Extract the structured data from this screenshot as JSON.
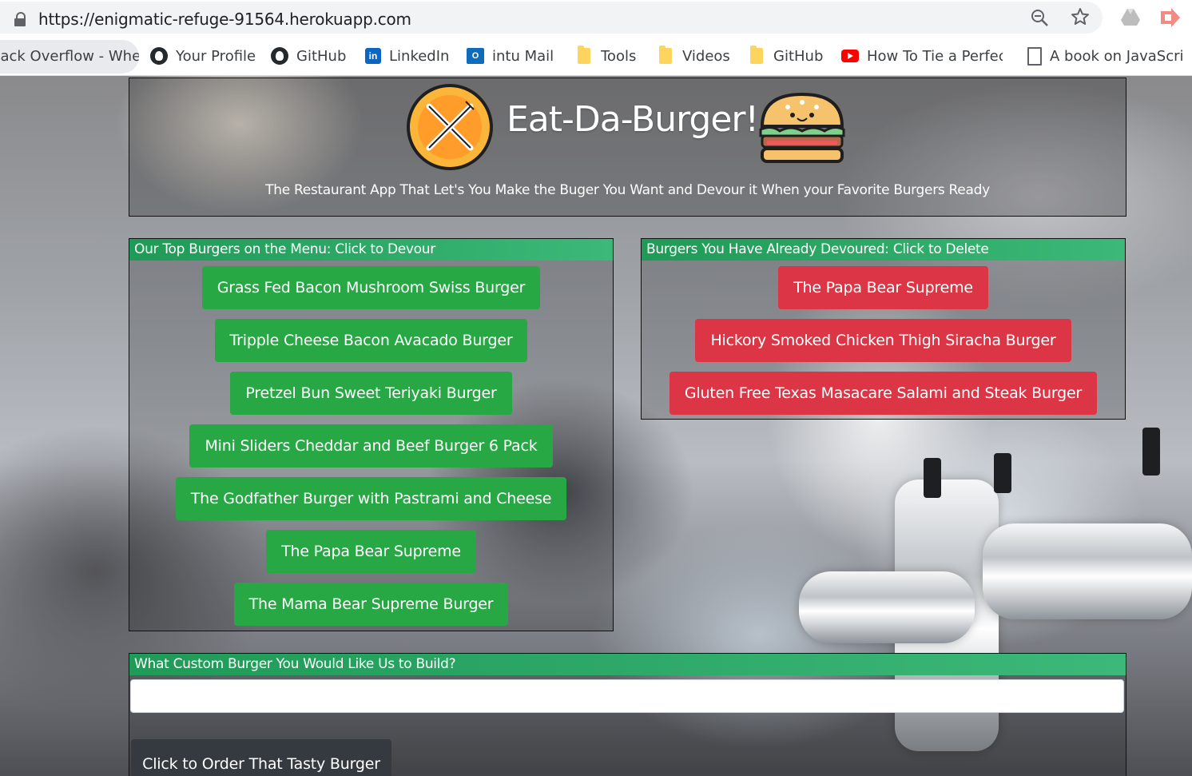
{
  "browser": {
    "url": "https://enigmatic-refuge-91564.herokuapp.com",
    "bookmarks": [
      {
        "label": "Stack Overflow - Whe",
        "icon": "stackoverflow-icon"
      },
      {
        "label": "Your Profile",
        "icon": "github-icon"
      },
      {
        "label": "GitHub",
        "icon": "github-icon"
      },
      {
        "label": "LinkedIn",
        "icon": "linkedin-icon"
      },
      {
        "label": "intu Mail",
        "icon": "outlook-icon"
      },
      {
        "label": "Tools",
        "icon": "folder-icon"
      },
      {
        "label": "Videos",
        "icon": "folder-icon"
      },
      {
        "label": "GitHub",
        "icon": "folder-icon"
      },
      {
        "label": "How To Tie a Perfect",
        "icon": "youtube-icon"
      },
      {
        "label": "A book on JavaScript",
        "icon": "document-icon"
      }
    ]
  },
  "header": {
    "title": "Eat-Da-Burger!",
    "tagline": "The Restaurant App That Let's You Make the Buger You Want and Devour it When your Favorite Burgers Ready"
  },
  "menu": {
    "heading": "Our Top Burgers on the Menu: Click to Devour",
    "burgers": [
      "Grass Fed Bacon Mushroom Swiss Burger",
      "Tripple Cheese Bacon Avacado Burger",
      "Pretzel Bun Sweet Teriyaki Burger",
      "Mini Sliders Cheddar and Beef Burger 6 Pack",
      "The Godfather Burger with Pastrami and Cheese",
      "The Papa Bear Supreme",
      "The Mama Bear Supreme Burger"
    ]
  },
  "devoured": {
    "heading": "Burgers You Have Already Devoured: Click to Delete",
    "burgers": [
      "The Papa Bear Supreme",
      "Hickory Smoked Chicken Thigh Siracha Burger",
      "Gluten Free Texas Masacare Salami and Steak Burger"
    ]
  },
  "order": {
    "heading": "What Custom Burger You Would Like Us to Build?",
    "input_value": "",
    "submit_label": "Click to Order That Tasty Burger"
  },
  "colors": {
    "green_button": "#28a745",
    "red_button": "#dc3545",
    "panel_header": "#1f9a57",
    "submit_button": "#343a40"
  }
}
